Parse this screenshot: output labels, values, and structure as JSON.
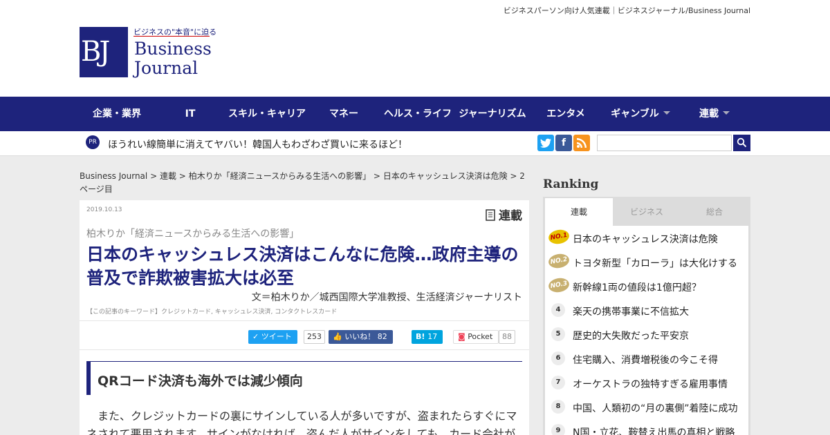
{
  "header": {
    "tagline": "ビジネスパーソン向け人気連載｜ビジネスジャーナル/Business Journal",
    "logo_mark": "BJ",
    "logo_sub": "ビジネスの\"本音\"に迫る",
    "logo_word1": "Business",
    "logo_word2": "Journal"
  },
  "nav": {
    "items": [
      {
        "label": "企業・業界"
      },
      {
        "label": "IT"
      },
      {
        "label": "スキル・キャリア"
      },
      {
        "label": "マネー"
      },
      {
        "label": "ヘルス・ライフ"
      },
      {
        "label": "ジャーナリズム"
      },
      {
        "label": "エンタメ"
      },
      {
        "label": "ギャンブル",
        "dropdown": true
      },
      {
        "label": "連載",
        "dropdown": true
      }
    ]
  },
  "subbar": {
    "pr_badge": "PR",
    "pr_text": "ほうれい線簡単に消えてヤバい！韓国人もわざわざ買いに来るほど！",
    "twitter": "t",
    "facebook": "f",
    "rss": "rss",
    "search_placeholder": ""
  },
  "breadcrumb": {
    "items": [
      "Business Journal",
      "連載",
      "柏木りか「経済ニュースからみる生活への影響」",
      "日本のキャッシュレス決済は危険",
      "2ページ目"
    ],
    "separator": ">"
  },
  "article": {
    "date": "2019.10.13",
    "badge": "連載",
    "series": "柏木りか「経済ニュースからみる生活への影響」",
    "title": "日本のキャッシュレス決済はこんなに危険…政府主導の普及で詐欺被害拡大は必至",
    "byline": "文＝柏木りか／城西国際大学准教授、生活経済ジャーナリスト",
    "keywords": "【この記事のキーワード】クレジットカード, キャッシュレス決済, コンタクトレスカード",
    "share": {
      "tweet_label": "ツイート",
      "tweet_count": "253",
      "like_label": "いいね！",
      "like_count": "82",
      "hatena_label": "B!",
      "hatena_count": "17",
      "pocket_label": "Pocket",
      "pocket_count": "88"
    },
    "section_heading": "QRコード決済も海外では減少傾向",
    "body": "　また、クレジットカードの裏にサインしている人が多いですが、盗まれたらすぐにマネされて悪用されます。サインがなければ、盗んだ人がサインをしても、カード会社が"
  },
  "ranking": {
    "title": "Ranking",
    "tabs": [
      "連載",
      "ビジネス",
      "総合"
    ],
    "active_tab": 0,
    "items": [
      {
        "rank": "NO.1",
        "title": "日本のキャッシュレス決済は危険"
      },
      {
        "rank": "NO.2",
        "title": "トヨタ新型「カローラ」は大化けする"
      },
      {
        "rank": "NO.3",
        "title": "新幹線1両の値段は1億円超？"
      },
      {
        "rank": "4",
        "title": "楽天の携帯事業に不信拡大"
      },
      {
        "rank": "5",
        "title": "歴史的大失敗だった平安京"
      },
      {
        "rank": "6",
        "title": "住宅購入、消費増税後の今こそ得"
      },
      {
        "rank": "7",
        "title": "オーケストラの独特すぎる雇用事情"
      },
      {
        "rank": "8",
        "title": "中国、人類初の“月の裏側”着陸に成功"
      },
      {
        "rank": "9",
        "title": "N国・立花、鞍替え出馬の真相と戦略"
      }
    ]
  },
  "colors": {
    "brand": "#1e237c",
    "twitter": "#1da1f2",
    "facebook": "#3b5998",
    "rss": "#f7931e",
    "hatena": "#00a4de",
    "pocket": "#ef4056"
  }
}
